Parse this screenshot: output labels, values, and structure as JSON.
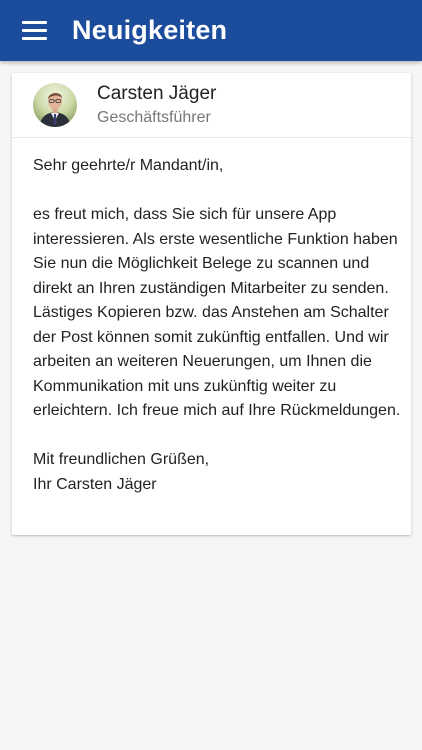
{
  "app_bar": {
    "title": "Neuigkeiten",
    "menu_icon": "hamburger-menu-icon",
    "background_color": "#1c4c9c"
  },
  "post": {
    "author": {
      "name": "Carsten Jäger",
      "role": "Geschäftsführer"
    },
    "greeting": "Sehr geehrte/r Mandant/in,",
    "body": "es freut mich, dass Sie sich für unsere App interessieren. Als erste wesentliche Funktion haben Sie nun die Möglichkeit Belege zu scannen und direkt an Ihren zuständigen Mitarbeiter zu senden. Lästiges Kopieren bzw. das Anstehen am Schalter der Post können somit zukünftig entfallen. Und wir arbeiten an weiteren Neuerungen, um Ihnen die Kommunikation mit uns zukünftig weiter zu erleichtern. Ich freue mich auf Ihre Rückmeldungen.",
    "closing": "Mit freundlichen Grüßen,\nIhr Carsten Jäger"
  }
}
